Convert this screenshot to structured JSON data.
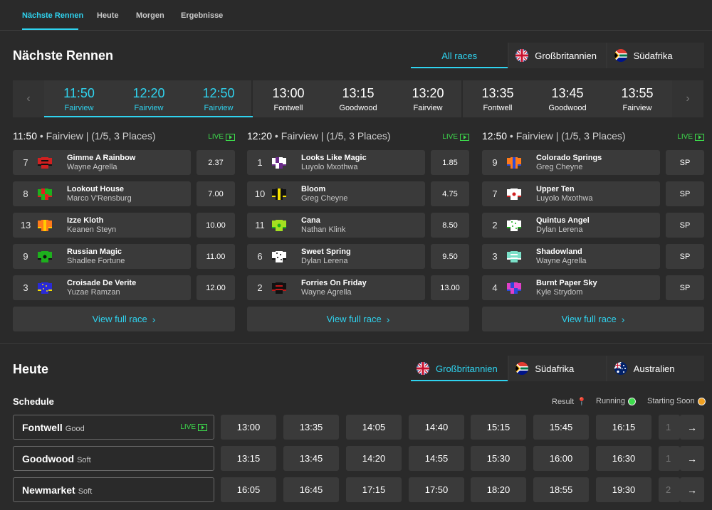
{
  "nav": {
    "tabs": [
      "Nächste Rennen",
      "Heute",
      "Morgen",
      "Ergebnisse"
    ],
    "active_index": 0
  },
  "next_races": {
    "title": "Nächste Rennen",
    "filters": [
      {
        "label": "All races",
        "flag": "none",
        "active": true
      },
      {
        "label": "Großbritannien",
        "flag": "uk-flag-icon",
        "active": false
      },
      {
        "label": "Südafrika",
        "flag": "south-africa-flag-icon",
        "active": false
      }
    ],
    "strip": {
      "prev_icon": "‹",
      "next_icon": "›",
      "slots": [
        {
          "time": "11:50",
          "venue": "Fairview",
          "selected": true
        },
        {
          "time": "12:20",
          "venue": "Fairview",
          "selected": true
        },
        {
          "time": "12:50",
          "venue": "Fairview",
          "selected": true
        },
        {
          "time": "13:00",
          "venue": "Fontwell",
          "selected": false
        },
        {
          "time": "13:15",
          "venue": "Goodwood",
          "selected": false
        },
        {
          "time": "13:20",
          "venue": "Fairview",
          "selected": false
        },
        {
          "time": "13:35",
          "venue": "Fontwell",
          "selected": false
        },
        {
          "time": "13:45",
          "venue": "Goodwood",
          "selected": false
        },
        {
          "time": "13:55",
          "venue": "Fairview",
          "selected": false
        }
      ]
    },
    "races": [
      {
        "time": "11:50",
        "info": " • Fairview | (1/5, 3 Places)",
        "live": "LIVE",
        "runners": [
          {
            "num": "7",
            "horse": "Gimme A Rainbow",
            "jockey": "Wayne Agrella",
            "odds": "2.37",
            "silk": [
              "#d02020",
              "#111111"
            ]
          },
          {
            "num": "8",
            "horse": "Lookout House",
            "jockey": "Marco V'Rensburg",
            "odds": "7.00",
            "silk": [
              "#1db01d",
              "#e02020"
            ]
          },
          {
            "num": "13",
            "horse": "Izze Kloth",
            "jockey": "Keanen Steyn",
            "odds": "10.00",
            "silk": [
              "#ff7a1a",
              "#ffcc00"
            ]
          },
          {
            "num": "9",
            "horse": "Russian Magic",
            "jockey": "Shadlee Fortune",
            "odds": "11.00",
            "silk": [
              "#1db01d",
              "#111111"
            ]
          },
          {
            "num": "3",
            "horse": "Croisade De Verite",
            "jockey": "Yuzae Ramzan",
            "odds": "12.00",
            "silk": [
              "#2a2ad8",
              "#f5e000"
            ]
          }
        ],
        "view_full": "View full race"
      },
      {
        "time": "12:20",
        "info": " • Fairview | (1/5, 3 Places)",
        "live": "LIVE",
        "runners": [
          {
            "num": "1",
            "horse": "Looks Like Magic",
            "jockey": "Luyolo Mxothwa",
            "odds": "1.85",
            "silk": [
              "#ffffff",
              "#6a2a8a"
            ]
          },
          {
            "num": "10",
            "horse": "Bloom",
            "jockey": "Greg Cheyne",
            "odds": "4.75",
            "silk": [
              "#111111",
              "#f5e000"
            ]
          },
          {
            "num": "11",
            "horse": "Cana",
            "jockey": "Nathan Klink",
            "odds": "8.50",
            "silk": [
              "#a4e020",
              "#1db01d"
            ]
          },
          {
            "num": "6",
            "horse": "Sweet Spring",
            "jockey": "Dylan Lerena",
            "odds": "9.50",
            "silk": [
              "#ffffff",
              "#111111"
            ]
          },
          {
            "num": "2",
            "horse": "Forries On Friday",
            "jockey": "Wayne Agrella",
            "odds": "13.00",
            "silk": [
              "#111111",
              "#c01818"
            ]
          }
        ],
        "view_full": "View full race"
      },
      {
        "time": "12:50",
        "info": " • Fairview | (1/5, 3 Places)",
        "live": "LIVE",
        "runners": [
          {
            "num": "9",
            "horse": "Colorado Springs",
            "jockey": "Greg Cheyne",
            "odds": "SP",
            "silk": [
              "#ff7a1a",
              "#2a4ad8"
            ]
          },
          {
            "num": "7",
            "horse": "Upper Ten",
            "jockey": "Luyolo Mxothwa",
            "odds": "SP",
            "silk": [
              "#ffffff",
              "#d02020"
            ]
          },
          {
            "num": "2",
            "horse": "Quintus Angel",
            "jockey": "Dylan Lerena",
            "odds": "SP",
            "silk": [
              "#ffffff",
              "#1db01d"
            ]
          },
          {
            "num": "3",
            "horse": "Shadowland",
            "jockey": "Wayne Agrella",
            "odds": "SP",
            "silk": [
              "#7ae0c8",
              "#ffffff"
            ]
          },
          {
            "num": "4",
            "horse": "Burnt Paper Sky",
            "jockey": "Kyle Strydom",
            "odds": "SP",
            "silk": [
              "#e040c8",
              "#2a4ad8"
            ]
          }
        ],
        "view_full": "View full race"
      }
    ]
  },
  "today": {
    "title": "Heute",
    "filters": [
      {
        "label": "Großbritannien",
        "flag": "uk-flag-icon",
        "active": true
      },
      {
        "label": "Südafrika",
        "flag": "south-africa-flag-icon",
        "active": false
      },
      {
        "label": "Australien",
        "flag": "australia-flag-icon",
        "active": false
      }
    ],
    "schedule_label": "Schedule",
    "legend": [
      {
        "label": "Result",
        "color": "#e53a3a"
      },
      {
        "label": "Running",
        "color": "#3ddc4c"
      },
      {
        "label": "Starting Soon",
        "color": "#f0a020"
      }
    ],
    "meetings": [
      {
        "name": "Fontwell",
        "going": "Good",
        "live": "LIVE",
        "times": [
          "13:00",
          "13:35",
          "14:05",
          "14:40",
          "15:15",
          "15:45",
          "16:15"
        ],
        "partial": "1"
      },
      {
        "name": "Goodwood",
        "going": "Soft",
        "live": "",
        "times": [
          "13:15",
          "13:45",
          "14:20",
          "14:55",
          "15:30",
          "16:00",
          "16:30"
        ],
        "partial": "1"
      },
      {
        "name": "Newmarket",
        "going": "Soft",
        "live": "",
        "times": [
          "16:05",
          "16:45",
          "17:15",
          "17:50",
          "18:20",
          "18:55",
          "19:30"
        ],
        "partial": "2"
      }
    ],
    "next_icon": "→"
  },
  "colors": {
    "accent": "#2fd3ef",
    "live": "#3ddc4c",
    "background": "#2a2a2a",
    "tile": "#3a3a3a"
  }
}
